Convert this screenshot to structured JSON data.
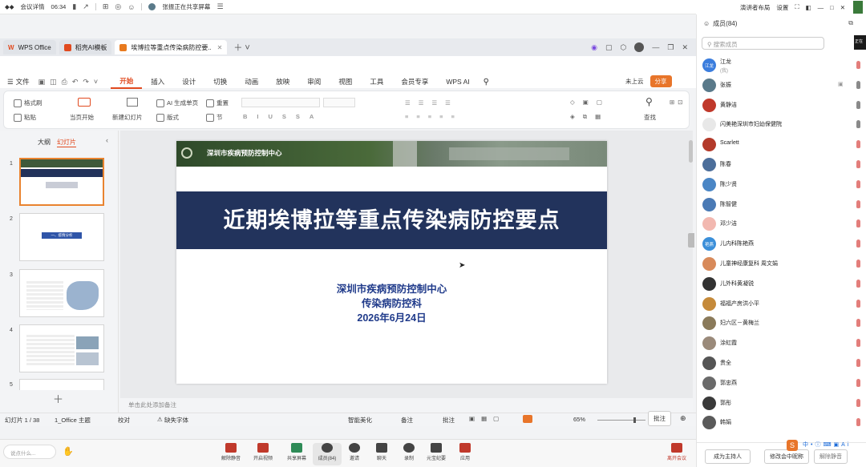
{
  "meeting_top": {
    "app": "会议详情",
    "time": "06:34",
    "sharing": "张振正在共享屏幕",
    "layout": "演讲者布局",
    "settings": "设置"
  },
  "tabs": [
    {
      "label": "WPS Office"
    },
    {
      "label": "稻壳AI模板"
    },
    {
      "label": "埃博拉等重点传染病防控要..."
    }
  ],
  "menu": [
    "文件",
    "开始",
    "插入",
    "设计",
    "切换",
    "动画",
    "放映",
    "审阅",
    "视图",
    "工具",
    "会员专享",
    "WPS AI"
  ],
  "ribbon": {
    "cloud": "未上云",
    "share": "分享",
    "format_painter": "格式刷",
    "paste": "粘贴",
    "from_current": "当页开始",
    "new_slide": "新建幻灯片",
    "ai_single": "AI 生成单页",
    "layout": "版式",
    "reset": "重置",
    "section": "节",
    "find": "查找"
  },
  "pane_tabs": {
    "outline": "大纲",
    "slides": "幻灯片"
  },
  "thumbs": [
    {
      "num": "1"
    },
    {
      "num": "2",
      "text": "一、疫情分析"
    },
    {
      "num": "3"
    },
    {
      "num": "4"
    },
    {
      "num": "5"
    }
  ],
  "slide": {
    "banner_text": "深圳市疾病预防控制中心",
    "title": "近期埃博拉等重点传染病防控要点",
    "org": "深圳市疾病预防控制中心",
    "dept": "传染病防控科",
    "date": "2026年6月24日"
  },
  "notes_placeholder": "单击此处添加备注",
  "status": {
    "slide": "幻灯片 1 / 38",
    "theme": "1_Office 主题",
    "proof": "校对",
    "font": "缺失字体",
    "beautify": "智能美化",
    "notes": "备注",
    "comment": "批注",
    "zoom": "65%",
    "annotate": "批注"
  },
  "meeting_bottom": {
    "buttons": [
      "解除静音",
      "开启视频",
      "共享屏幕",
      "成员(84)",
      "邀请",
      "聊天",
      "录制",
      "元宝纪要",
      "应用"
    ],
    "leave": "离开会议",
    "chat_placeholder": "说点什么..."
  },
  "panel": {
    "header": "成员(84)",
    "search": "搜索成员",
    "members": [
      {
        "name": "江龙",
        "sub": "(我)",
        "avatar": "江龙",
        "color": "#3b7ddd"
      },
      {
        "name": "张振",
        "avatar": "",
        "color": "#5a7a8a"
      },
      {
        "name": "黄静洁",
        "avatar": "",
        "color": "#c0392b"
      },
      {
        "name": "闪美艳深圳市妇幼保健院",
        "avatar": "",
        "color": "#e8e8e8"
      },
      {
        "name": "Scarlett",
        "avatar": "",
        "color": "#b33a2a"
      },
      {
        "name": "陈春",
        "avatar": "",
        "color": "#4c6e9a"
      },
      {
        "name": "陈少贤",
        "avatar": "",
        "color": "#4a86c5"
      },
      {
        "name": "陈智健",
        "avatar": "",
        "color": "#4a7ab5"
      },
      {
        "name": "邓少洁",
        "avatar": "",
        "color": "#f2b8b0"
      },
      {
        "name": "儿内科陈艳燕",
        "avatar": "艳燕",
        "color": "#3b8fd9"
      },
      {
        "name": "儿童神经康复科 周文娟",
        "avatar": "",
        "color": "#d88a5a"
      },
      {
        "name": "儿外科黄凝锐",
        "avatar": "",
        "color": "#333"
      },
      {
        "name": "福福产房洪小平",
        "avatar": "",
        "color": "#c58a3a"
      },
      {
        "name": "妇六区－黄梅兰",
        "avatar": "",
        "color": "#8a7a5a"
      },
      {
        "name": "涂虹霞",
        "avatar": "",
        "color": "#9a8a7a"
      },
      {
        "name": "贵全",
        "avatar": "",
        "color": "#555"
      },
      {
        "name": "郭忠燕",
        "avatar": "",
        "color": "#6a6a6a"
      },
      {
        "name": "郭彤",
        "avatar": "",
        "color": "#3a3a3a"
      },
      {
        "name": "韩娟",
        "avatar": "",
        "color": "#5a5a5a"
      }
    ],
    "host_btn": "成为主持人",
    "rename_btn": "修改会中昵称",
    "fake_btn": "解除静音"
  }
}
